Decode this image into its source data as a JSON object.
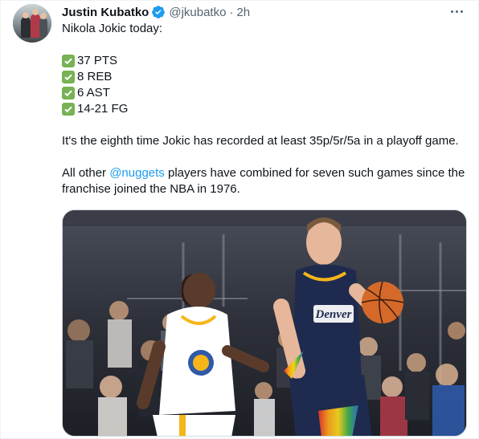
{
  "author": {
    "display_name": "Justin Kubatko",
    "handle": "@jkubatko",
    "separator": "·",
    "time": "2h",
    "verified_icon": "verified-badge-icon",
    "verified_color": "#1d9bf0"
  },
  "tweet": {
    "intro": "Nikola Jokic today:",
    "stats": [
      "37 PTS",
      "8 REB",
      "6 AST",
      "14-21 FG"
    ],
    "stat_icon": "check-mark-button-emoji",
    "paragraph1": "It's the eighth time Jokic has recorded at least 35p/5r/5a in a playoff game.",
    "paragraph2_before": "All other ",
    "mention": "@nuggets",
    "paragraph2_after": " players have combined for seven such games since the",
    "paragraph2_line2": "franchise joined the NBA in 1976.",
    "jersey_text": "Denver"
  },
  "colors": {
    "link": "#1d9bf0",
    "muted": "#536471",
    "check": "#77b255"
  }
}
